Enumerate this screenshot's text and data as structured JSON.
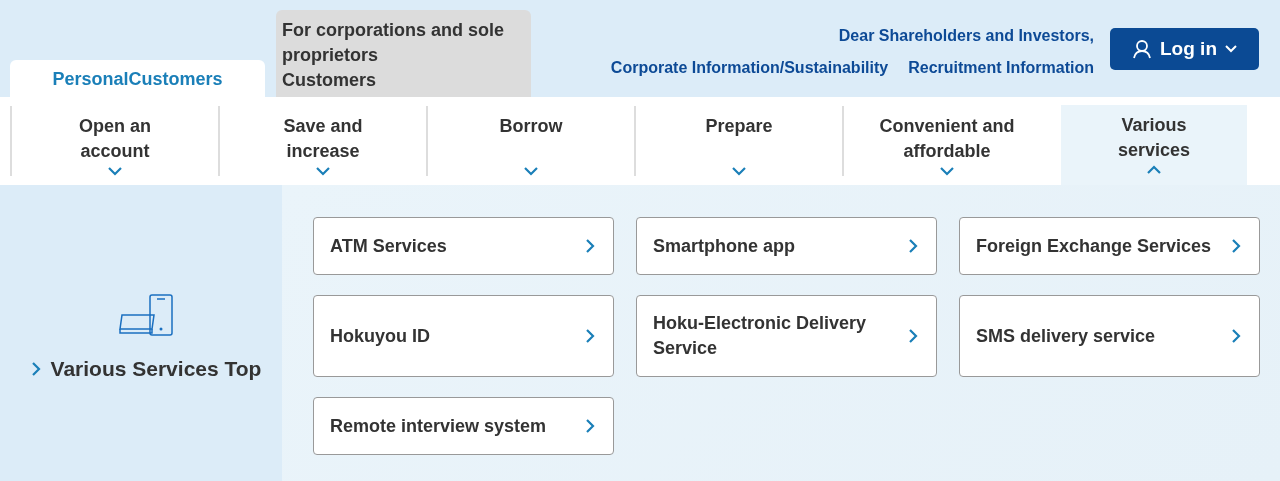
{
  "customer_tabs": [
    {
      "label": "PersonalCustomers",
      "selected": true
    },
    {
      "label": "For corporations and sole proprietors\nCustomers",
      "selected": false
    }
  ],
  "header_links": [
    "Dear Shareholders and Investors,",
    "Corporate Information/Sustainability",
    "Recruitment Information"
  ],
  "login_button": {
    "label": "Log in"
  },
  "nav": [
    {
      "label": "Open an account",
      "expanded": false
    },
    {
      "label": "Save and increase",
      "expanded": false
    },
    {
      "label": "Borrow",
      "expanded": false
    },
    {
      "label": "Prepare",
      "expanded": false
    },
    {
      "label": "Convenient and affordable",
      "expanded": false
    },
    {
      "label": "Various services",
      "expanded": true
    }
  ],
  "panel": {
    "top_link": "Various Services Top",
    "cards": [
      {
        "label": "ATM Services"
      },
      {
        "label": "Smartphone app"
      },
      {
        "label": "Foreign Exchange Services"
      },
      {
        "label": "Hokuyou ID"
      },
      {
        "label": "Hoku-Electronic Delivery Service"
      },
      {
        "label": "SMS delivery service"
      },
      {
        "label": "Remote interview system"
      }
    ]
  }
}
